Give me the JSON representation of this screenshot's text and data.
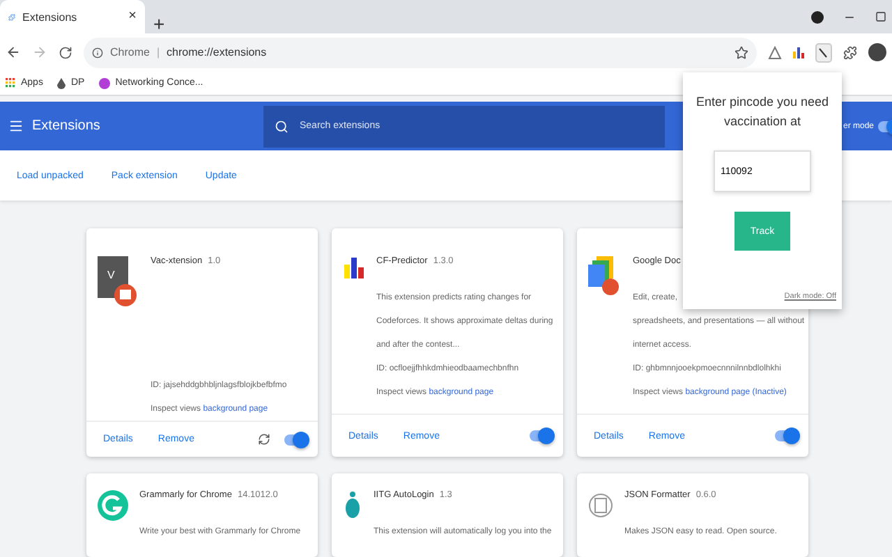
{
  "tab": {
    "title": "Extensions",
    "close": "×",
    "new_tab": "+"
  },
  "address": {
    "site": "Chrome",
    "separator": "|",
    "url": "chrome://extensions"
  },
  "bookmarks": [
    {
      "label": "Apps",
      "kind": "apps"
    },
    {
      "label": "DP",
      "kind": "drop"
    },
    {
      "label": "Networking Conce...",
      "kind": "circle"
    }
  ],
  "header": {
    "title": "Extensions",
    "search_placeholder": "Search extensions",
    "developer_mode": {
      "label": "er mode",
      "on": true
    }
  },
  "actions": [
    "Load unpacked",
    "Pack extension",
    "Update"
  ],
  "cards": [
    {
      "name": "Vac-xtension",
      "version": "1.0",
      "icon_letter": "V",
      "id": "ID: jajsehddgbhbljnlagsfblojkbefbfmo",
      "inspect": "Inspect views",
      "link": "background page",
      "buttons": [
        "Details",
        "Remove"
      ],
      "reload": true,
      "enabled": true
    },
    {
      "name": "CF-Predictor",
      "version": "1.3.0",
      "description": [
        "This extension predicts rating changes for",
        "Codeforces. It shows approximate deltas during",
        "and after the contest..."
      ],
      "id": "ID: ocfloejjfhhkdmhieodbaamechbnfhn",
      "inspect": "Inspect views",
      "link": "background page",
      "buttons": [
        "Details",
        "Remove"
      ],
      "reload": false,
      "enabled": true
    },
    {
      "name": "Google Doc",
      "description": [
        "Edit, create,",
        "spreadsheets, and presentations — all without",
        "internet access."
      ],
      "id": "ID: ghbmnnjooekpmoecnnnilnnbdlolhkhi",
      "inspect": "Inspect views",
      "link": "background page",
      "link_note": "(Inactive)",
      "buttons": [
        "Details",
        "Remove"
      ],
      "reload": false,
      "enabled": true
    }
  ],
  "more_cards": [
    {
      "name": "Grammarly for Chrome",
      "version": "14.1012.0",
      "line": "Write your best with Grammarly for Chrome"
    },
    {
      "name": "IITG AutoLogin",
      "version": "1.3",
      "line": "This extension will automatically log you into the"
    },
    {
      "name": "JSON Formatter",
      "version": "0.6.0",
      "line": "Makes JSON easy to read. Open source."
    }
  ],
  "popup": {
    "prompt": "Enter pincode you need vaccination at",
    "value": "110092",
    "button": "Track",
    "dark_mode": "Dark mode: Off"
  }
}
